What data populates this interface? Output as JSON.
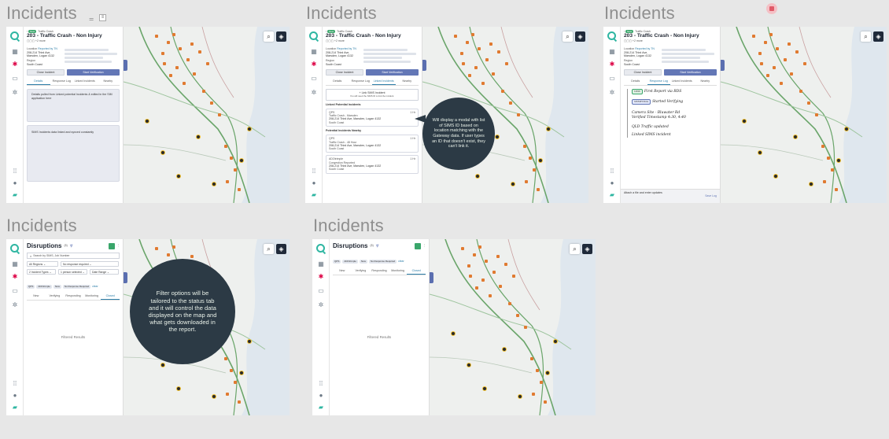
{
  "frames": [
    {
      "label": "Incidents",
      "badge": "New",
      "category": "Traffic Crash",
      "title": "203 - Traffic Crash - Non Injury",
      "meta": "+2 more",
      "location_label": "Location",
      "location_reported": "Reported by TN",
      "location_value": "208-214 Third Ave, Marsden, Logan 4132",
      "region_label": "Region",
      "region_value": "South Coast",
      "close_btn": "Close Incident",
      "start_btn": "Start Verification",
      "tabs": [
        "Details",
        "Response Log",
        "Linked Incidents",
        "Nearby"
      ],
      "box1": "Details pulled from Linked potential Incidents & edited in the SIM application here",
      "box2": "SIMS Incidents data linked and synced constantly"
    },
    {
      "label": "Incidents",
      "badge": "New",
      "category": "Traffic Crash",
      "title": "203 - Traffic Crash - Non Injury",
      "meta": "+2 more",
      "location_label": "Location",
      "location_reported": "Reported by TN",
      "location_value": "208-214 Third Ave, Marsden, Logan 4132",
      "region_label": "Region",
      "region_value": "South Coast",
      "close_btn": "Close Incident",
      "start_btn": "Start Verification",
      "tabs": [
        "Details",
        "Response Log",
        "Linked Incidents",
        "Nearby"
      ],
      "link_btn": "+ Link SIMS Incident",
      "link_sub": "You will need the SIMS ID to link the incident.",
      "linked_heading": "Linked Potential Incidents",
      "nearby_heading": "Potential Incidents Nearby",
      "cards": [
        {
          "src": "QPS",
          "type": "Traffic Crash - Marsden",
          "addr": "208-214 Third Ave, Marsden, Logan 4132",
          "region": "South Coast",
          "time": "1 Hr"
        },
        {
          "src": "QPS",
          "type": "Traffic Crash - 48 Hour",
          "addr": "208-214 Third Ave, Marsden, Logan 4132",
          "region": "South Coast",
          "time": "1 Hr"
        },
        {
          "src": "ADOtrimple",
          "type": "Congestion Reported",
          "addr": "208-214 Third Ave, Marsden, Logan 4132",
          "region": "South Coast",
          "time": "1 Hr"
        }
      ],
      "bubble": "Will display a modal with list of SIMS ID based on location matching with the Gateway data. If user types an ID that doesn't exist, they can't link it."
    },
    {
      "label": "Incidents",
      "badge": "New",
      "category": "Traffic Crash",
      "title": "203 - Traffic Crash - Non Injury",
      "meta": "+2 more",
      "location_label": "Location",
      "location_reported": "Reported by TN",
      "location_value": "208-214 Third Ave, Marsden, Logan 4132",
      "region_label": "Region",
      "region_value": "South Coast",
      "close_btn": "Close Incident",
      "start_btn": "Start Verification",
      "tabs": [
        "Details",
        "Response Log",
        "Linked Incidents",
        "Nearby"
      ],
      "log": [
        {
          "tag": "NEW",
          "text": "First Report via RDS"
        },
        {
          "tag": "VERIFYING",
          "text": "Started Verifying"
        },
        {
          "tag": "",
          "text": "Camera Site - Bluwater Rd"
        },
        {
          "tag": "",
          "text": "Verified Timestamp 4:30, 4:40"
        },
        {
          "tag": "",
          "text": "QLD Traffic updated"
        },
        {
          "tag": "",
          "text": "Linked SIMS incident"
        }
      ],
      "attach": "Attach a file and enter updates",
      "save": "Save Log"
    },
    {
      "label": "Incidents",
      "heading": "Disruptions",
      "count": "(5)",
      "search_placeholder": "Search by SIMS, Job Number",
      "filters": [
        "All Regions",
        "No response required",
        "2 Incident Types",
        "1 person selected",
        "Date Range"
      ],
      "chips": [
        "QPS",
        "ADOtrimple",
        "New",
        "No Response Required"
      ],
      "chips_more": "clear",
      "status_tabs": [
        "New",
        "Verifying",
        "Responding",
        "Monitoring",
        "Closed"
      ],
      "empty": "Filtered Results",
      "bubble": "Filter options will be tailored to the status tab and it will control the data displayed on the map and what gets downloaded in the report."
    },
    {
      "label": "Incidents",
      "heading": "Disruptions",
      "count": "(5)",
      "chips": [
        "QPS",
        "ADOtrimple",
        "New",
        "No Response Required"
      ],
      "chips_more": "clear",
      "status_tabs": [
        "New",
        "Verifying",
        "Responding",
        "Monitoring",
        "Closed"
      ],
      "empty": "Filtered Results"
    }
  ],
  "colors": {
    "accent": "#2e7fa9",
    "primary_button": "#6377b6",
    "bubble": "#2c3a45",
    "badge": "#3aa66b",
    "pin": "#e07a30"
  }
}
